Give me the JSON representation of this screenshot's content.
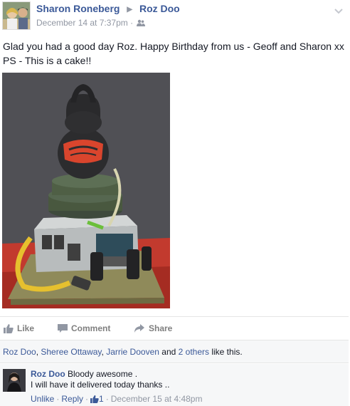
{
  "post": {
    "author": "Sharon Roneberg",
    "recipient": "Roz Doo",
    "timestamp": "December 14 at 7:37pm",
    "meta_sep": "·",
    "audience_icon": "friends-icon",
    "text_line1": "Glad you had a good day Roz. Happy Birthday from us - Geoff and Sharon xx",
    "text_line2": "PS - This is a cake!!"
  },
  "actions": {
    "like": "Like",
    "comment": "Comment",
    "share": "Share"
  },
  "likes": {
    "names": [
      "Roz Doo",
      "Sheree Ottaway",
      "Jarrie Dooven"
    ],
    "comma": ",",
    "and": "and",
    "others": "2 others",
    "suffix": "like this."
  },
  "comment": {
    "author": "Roz Doo",
    "line1": "Bloody awesome .",
    "line2": "I will have it delivered today thanks ..",
    "unlike": "Unlike",
    "reply": "Reply",
    "like_count": "1",
    "timestamp": "December 15 at 4:48pm",
    "sep": "·"
  },
  "colors": {
    "link": "#3b5998",
    "muted": "#9197a3",
    "action_gray": "#7f7f7f",
    "panel_bg": "#f6f7f8"
  }
}
